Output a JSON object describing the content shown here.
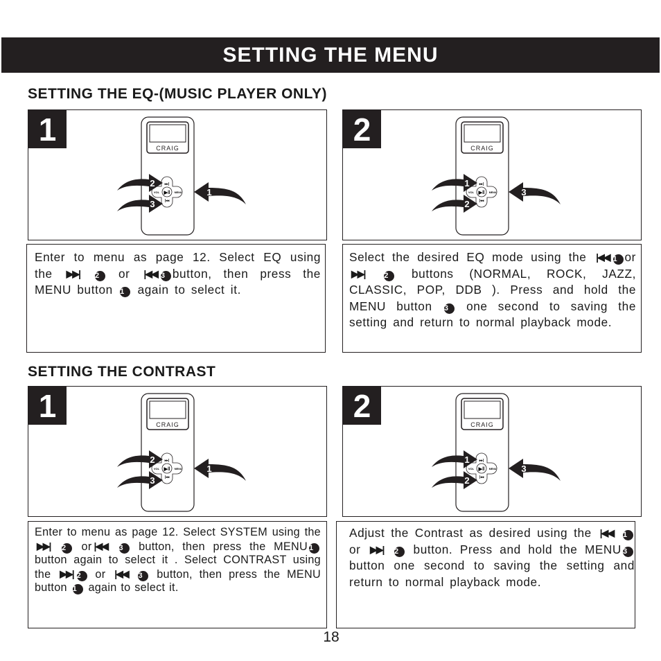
{
  "header": {
    "title": "SETTING THE MENU"
  },
  "sections": [
    {
      "title": "SETTING THE EQ-(MUSIC PLAYER ONLY)",
      "steps": [
        {
          "number": "1",
          "brand": "CRAIG",
          "callouts": {
            "up": "2",
            "down": "3",
            "right": "1"
          },
          "buttons": {
            "vol": "VOL",
            "menu": "MENU"
          },
          "text": [
            "Enter to menu as page 12. Select EQ using the",
            "or",
            "button, then press the MENU button",
            "again to select it."
          ]
        },
        {
          "number": "2",
          "brand": "CRAIG",
          "callouts": {
            "up": "1",
            "down": "2",
            "right": "3"
          },
          "buttons": {
            "vol": "VOL",
            "menu": "MENU"
          },
          "text": [
            "or",
            "buttons (NORMAL, ROCK, JAZZ, CLASSIC, POP, DDB ). Press and hold the MENU button",
            "one second to saving the setting and return to normal playback mode.",
            "Select the desired EQ mode using the"
          ]
        }
      ]
    },
    {
      "title": "SETTING THE CONTRAST",
      "steps": [
        {
          "number": "1",
          "brand": "CRAIG",
          "callouts": {
            "up": "2",
            "down": "3",
            "right": "1"
          },
          "buttons": {
            "vol": "VOL",
            "menu": "MENU"
          },
          "text": [
            "Enter to menu as page 12. Select SYSTEM using the",
            "or",
            "button, then press the MENU",
            "button again to select it . Select CONTRAST using the",
            "or",
            "button, then press the MENU button",
            "again to select it."
          ]
        },
        {
          "number": "2",
          "brand": "CRAIG",
          "callouts": {
            "up": "1",
            "down": "2",
            "right": "3"
          },
          "buttons": {
            "vol": "VOL",
            "menu": "MENU"
          },
          "text": [
            "Adjust the Contrast as desired using the",
            "or",
            "button. Press and hold the MENU",
            "button one second to saving the setting and return to normal playback mode."
          ]
        }
      ]
    }
  ],
  "glyphs": {
    "next": "▶▶|",
    "prev": "|◀◀",
    "c1": "1",
    "c2": "2",
    "c3": "3"
  },
  "page_number": "18",
  "colors": {
    "ink": "#231f20",
    "paper": "#ffffff"
  }
}
